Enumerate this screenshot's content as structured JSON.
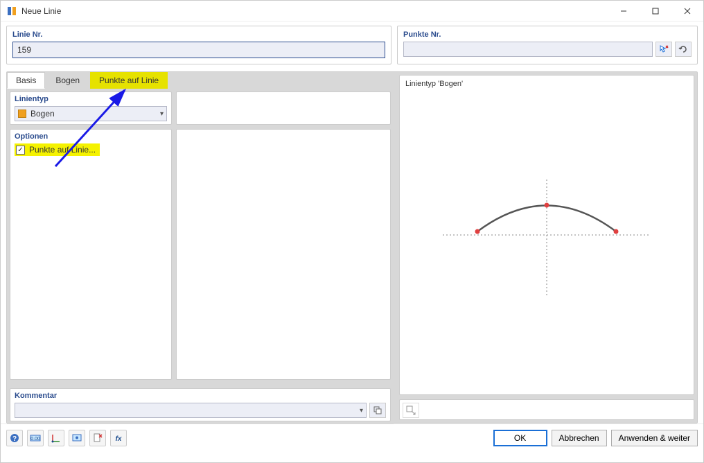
{
  "window": {
    "title": "Neue Linie"
  },
  "header": {
    "linie_nr_label": "Linie Nr.",
    "linie_nr_value": "159",
    "punkte_nr_label": "Punkte Nr.",
    "punkte_nr_value": ""
  },
  "tabs": {
    "basis": "Basis",
    "bogen": "Bogen",
    "punkte_auf_linie": "Punkte auf Linie"
  },
  "linientyp": {
    "label": "Linientyp",
    "value": "Bogen",
    "color": "#f0a020"
  },
  "optionen": {
    "label": "Optionen",
    "punkte_auf_linie": "Punkte auf Linie..."
  },
  "kommentar": {
    "label": "Kommentar",
    "value": ""
  },
  "preview": {
    "title": "Linientyp 'Bogen'"
  },
  "footer": {
    "ok": "OK",
    "cancel": "Abbrechen",
    "apply_next": "Anwenden & weiter"
  },
  "icons": {
    "pick_arrow": "pick",
    "undo": "undo",
    "copy": "copy",
    "fx": "fx"
  }
}
